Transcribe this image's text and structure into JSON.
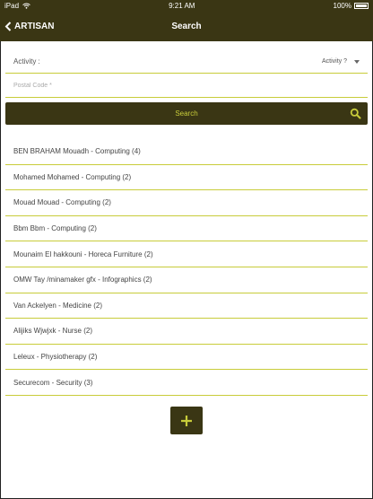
{
  "status_bar": {
    "device": "iPad",
    "time": "9:21 AM",
    "battery": "100%"
  },
  "nav": {
    "back_label": "ARTISAN",
    "title": "Search"
  },
  "form": {
    "activity_label": "Activity :",
    "activity_value": "Activity ?",
    "postal_placeholder": "Postal Code *",
    "postal_value": ""
  },
  "search_button": {
    "label": "Search"
  },
  "results": [
    "BEN BRAHAM Mouadh - Computing (4)",
    "Mohamed Mohamed - Computing (2)",
    "Mouad Mouad - Computing (2)",
    "Bbm Bbm - Computing (2)",
    "Mounaim El hakkouni - Horeca Furniture (2)",
    "OMW Tay /minamaker gfx - Infographics (2)",
    "Van Ackelyen - Medicine (2)",
    "Alijiks Wjwjxk - Nurse (2)",
    "Leleux - Physiotherapy (2)",
    "Securecom - Security (3)"
  ],
  "colors": {
    "primary": "#3a3614",
    "accent": "#c8cc3a",
    "background": "#ffffff"
  },
  "icons": {
    "back": "chevron-left-icon",
    "search": "search-icon",
    "add": "plus-icon",
    "wifi": "wifi-icon",
    "battery": "battery-icon"
  }
}
